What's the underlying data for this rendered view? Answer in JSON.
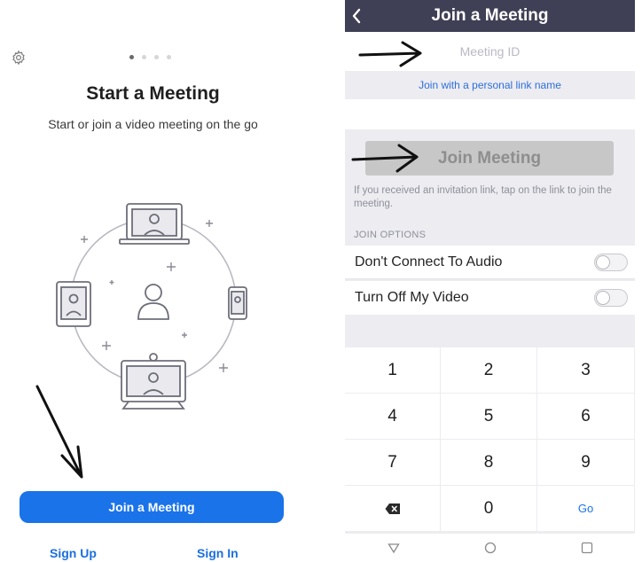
{
  "left": {
    "pager": {
      "count": 4,
      "active": 0
    },
    "title": "Start a Meeting",
    "subtitle": "Start or join a video meeting on the go",
    "join_button": "Join a Meeting",
    "sign_up": "Sign Up",
    "sign_in": "Sign In",
    "icons": {
      "settings": "gear-icon"
    },
    "accent": "#1a73e8"
  },
  "right": {
    "header": {
      "title": "Join a Meeting",
      "back_icon": "chevron-left-icon",
      "bg": "#3f3f55"
    },
    "meeting_id_placeholder": "Meeting ID",
    "personal_link": "Join with a personal link name",
    "join_button": "Join Meeting",
    "hint": "If you received an invitation link, tap on the link to join the meeting.",
    "options_label": "JOIN OPTIONS",
    "options": [
      {
        "label": "Don't Connect To Audio",
        "on": false
      },
      {
        "label": "Turn Off My Video",
        "on": false
      }
    ],
    "keypad": [
      "1",
      "2",
      "3",
      "4",
      "5",
      "6",
      "7",
      "8",
      "9",
      "",
      "0",
      "Go"
    ]
  }
}
